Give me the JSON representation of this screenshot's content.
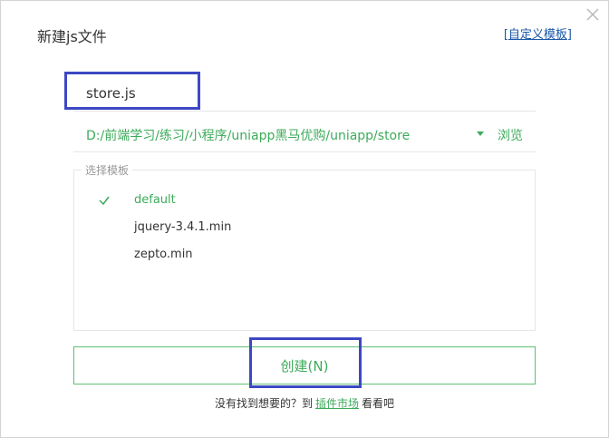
{
  "dialog": {
    "title": "新建js文件",
    "custom_template_link": "自定义模板",
    "bracket_open": "[",
    "bracket_close": "]"
  },
  "filename": {
    "value": "store.js"
  },
  "path": {
    "value": "D:/前端学习/练习/小程序/uniapp黑马优购/uniapp/store",
    "browse_label": "浏览"
  },
  "templates": {
    "legend": "选择模板",
    "items": [
      {
        "label": "default",
        "selected": true
      },
      {
        "label": "jquery-3.4.1.min",
        "selected": false
      },
      {
        "label": "zepto.min",
        "selected": false
      }
    ]
  },
  "create_button": {
    "label": "创建(N)"
  },
  "footer": {
    "prefix": "没有找到想要的？到",
    "market_link": "插件市场",
    "suffix": "看看吧"
  },
  "colors": {
    "accent_green": "#3cab5a",
    "highlight_blue": "#3d48c4",
    "link_blue": "#1a57a8"
  }
}
